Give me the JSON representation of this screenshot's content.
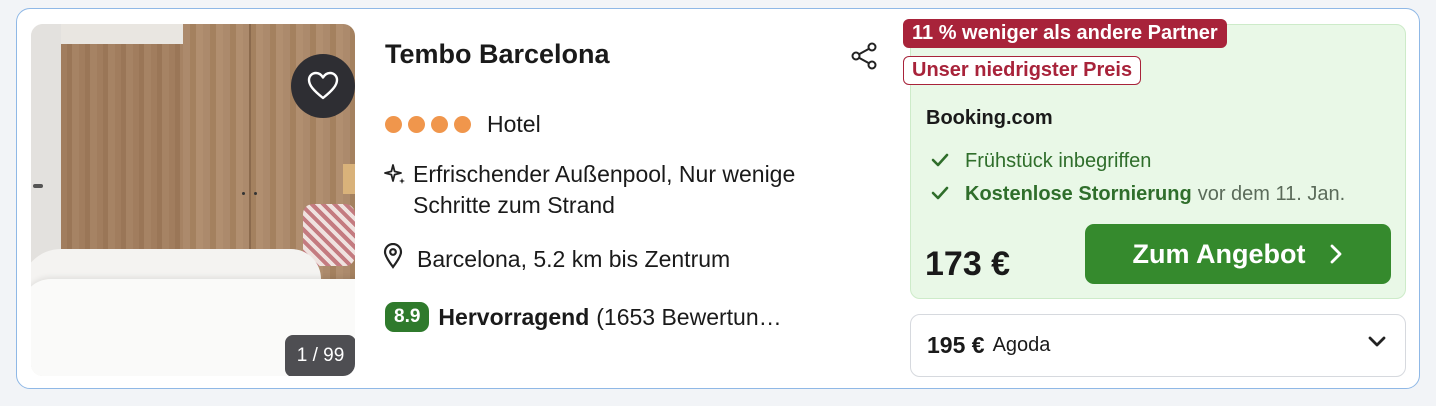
{
  "hotel": {
    "name": "Tembo Barcelona",
    "type": "Hotel",
    "stars": 4,
    "feature": "Erfrischender Außenpool, Nur wenige Schritte zum Strand",
    "location": "Barcelona, 5.2 km bis Zentrum",
    "rating_score": "8.9",
    "rating_label": "Hervorragend",
    "rating_reviews": "(1653 Bewertun…",
    "photo_counter": "1 / 99"
  },
  "offer": {
    "badge_saving": "11 % weniger als andere Partner",
    "badge_lowest": "Unser niedrigster Preis",
    "provider": "Booking.com",
    "perk_breakfast": "Frühstück inbegriffen",
    "perk_cancel_bold": "Kostenlose Stornierung",
    "perk_cancel_rest": "vor dem 11. Jan.",
    "price": "173 €",
    "cta_label": "Zum Angebot"
  },
  "alt_offer": {
    "price": "195 €",
    "provider": "Agoda"
  },
  "icons": [
    "heart-icon",
    "share-icon",
    "sparkle-icon",
    "location-pin-icon",
    "check-icon",
    "chevron-right-icon",
    "chevron-down-icon"
  ],
  "colors": {
    "accent_green": "#358a2d",
    "badge_red": "#a8233a",
    "star_orange": "#f0964c",
    "offer_bg": "#e9f8e7"
  }
}
